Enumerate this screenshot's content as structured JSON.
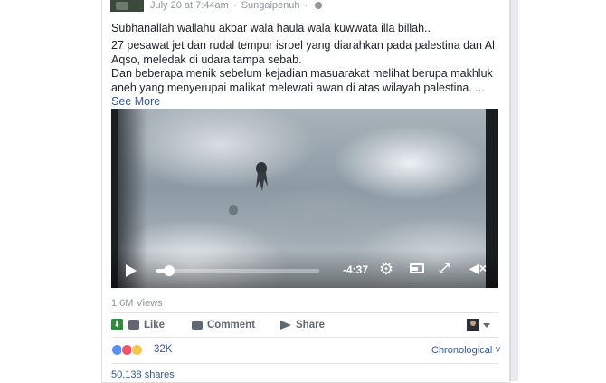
{
  "post": {
    "timestamp": "July 20 at 7:44am",
    "separator": "·",
    "location": "Sungaipenuh",
    "line1": "Subhanallah wallahu akbar wala haula wala kuwwata illa billah..",
    "body": "27 pesawat jet dan rudal tempur isroel yang diarahkan pada palestina dan Al Aqso, meledak di udara tampa sebab.\nDan beberapa menik sebelum kejadian masuarakat melihat berupa makhluk aneh yang menyerupai malikat melewati awan di atas wilayah palestina. ...",
    "see_more": "See More"
  },
  "video": {
    "time_remaining": "-4:37",
    "progress": 0.08,
    "icons": {
      "play": "play-icon",
      "settings": "gear-icon",
      "pip": "picture-in-picture-icon",
      "fullscreen": "fullscreen-icon",
      "volume": "mute-icon"
    }
  },
  "stats": {
    "views": "1.6M Views",
    "reactions_count": "32K",
    "shares": "50,138 shares"
  },
  "actions": {
    "like": "Like",
    "comment": "Comment",
    "share": "Share"
  },
  "sort": {
    "label": "Chronological",
    "caret": "˅"
  },
  "colors": {
    "link": "#365899",
    "muted": "#90949c",
    "like_reaction": "#5890ff",
    "love_reaction": "#f25268",
    "wow_reaction": "#f7c64a",
    "download": "#2e8b3e"
  }
}
